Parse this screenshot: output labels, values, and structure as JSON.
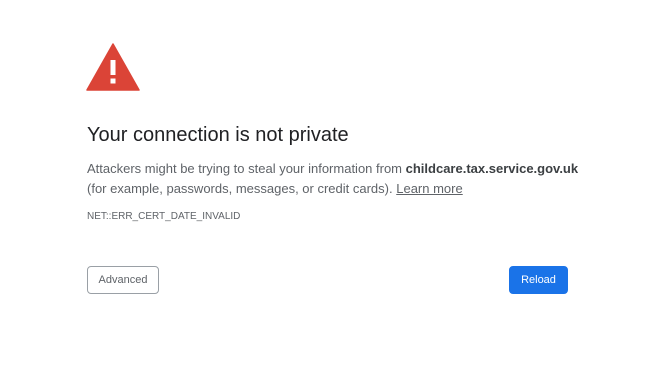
{
  "interstitial": {
    "icon": "warning-triangle-icon",
    "icon_color": "#db4437",
    "title": "Your connection is not private",
    "body_before": "Attackers might be trying to steal your information from ",
    "domain": "childcare.tax.service.gov.uk",
    "body_after": " (for example, passwords, messages, or credit cards). ",
    "learn_more": "Learn more",
    "error_code": "NET::ERR_CERT_DATE_INVALID"
  },
  "buttons": {
    "advanced_label": "Advanced",
    "reload_label": "Reload",
    "reload_color": "#1a73e8"
  }
}
